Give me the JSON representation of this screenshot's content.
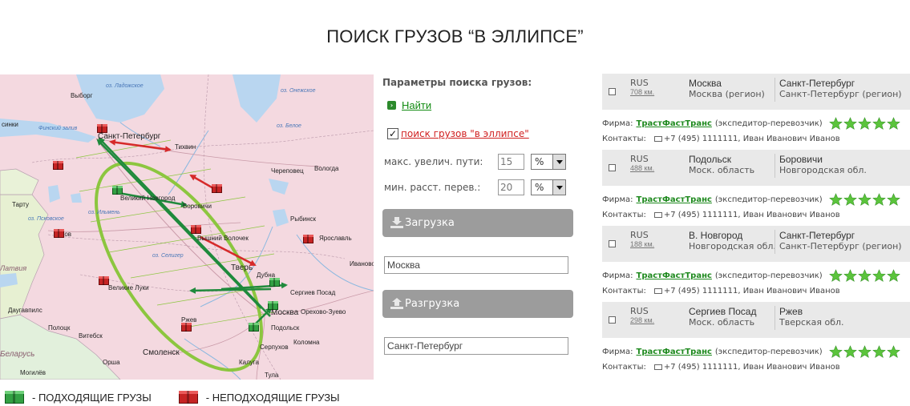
{
  "page": {
    "title": "ПОИСК ГРУЗОВ “В ЭЛЛИПСЕ”"
  },
  "map": {
    "labels": {
      "sinki": "синки",
      "finsky": "Финский залив",
      "vyborg": "Выборг",
      "ladoga": "оз. Ладожское",
      "onega": "оз. Онежское",
      "petersburg": "Санкт-Петербург",
      "tikhvin": "Тихвин",
      "cherepovets": "Череповец",
      "vologda": "Вологда",
      "beloe": "оз. Белое",
      "ilmen": "оз. Ильмень",
      "novgorod": "Великий Новгород",
      "tartu": "Тарту",
      "pskovskoe": "оз. Псковское",
      "pskov": "Псков",
      "borovichi": "Боровичи",
      "rybinsk": "Рыбинск",
      "yaroslavl": "Ярославль",
      "vyshny": "Вышний Волочёк",
      "vyshny_short": "Вышний Волочек",
      "seliger": "оз. Селигер",
      "tver": "Тверь",
      "ivanovo": "Иваново",
      "velikie_luki": "Великие Луки",
      "sergiev": "Сергиев Посад",
      "orekhovo": "Орехово-Зуево",
      "moskva": "Москва",
      "smolensk": "Смоленск",
      "kaluga": "Калуга",
      "tula": "Тула",
      "serpukhov": "Серпухов",
      "kolomna": "Коломна",
      "dubna": "Дубна",
      "rzhev": "Ржев",
      "podolsk": "Подольск",
      "vitebsk": "Витебск",
      "polotsk": "Полоцк",
      "daugavpils": "Даугавпилс",
      "orsha": "Орша",
      "moghilev": "Могилёв",
      "belarus": "Беларусь",
      "latvia": "Латвия"
    }
  },
  "params": {
    "heading": "Параметры поиска грузов:",
    "find_link": "Найти",
    "ellipse_checked": "✓",
    "ellipse_label": "поиск грузов \"в эллипсе\"",
    "max_path_label": "макс. увелич. пути:",
    "max_path_value": "15",
    "max_path_unit": "%",
    "min_dist_label": "мин. расст. перев.:",
    "min_dist_value": "20",
    "min_dist_unit": "%",
    "load_label": "Загрузка",
    "load_city": "Москва",
    "unload_label": "Разгрузка",
    "unload_city": "Санкт-Петербург"
  },
  "results": [
    {
      "country": "RUS",
      "km": "708 км.",
      "from": "Москва",
      "from_region": "Москва (регион)",
      "to": "Санкт-Петербург",
      "to_region": "Санкт-Петербург (регион)",
      "firm_label": "Фирма:",
      "firm_name": "ТрастФастТранс",
      "firm_type": "(экспедитор-перевозчик)",
      "contact_label": "Контакты:",
      "contact": "+7 (495) 1111111, Иван Иванович Иванов"
    },
    {
      "country": "RUS",
      "km": "488 км.",
      "from": "Подольск",
      "from_region": "Моск. область",
      "to": "Боровичи",
      "to_region": "Новгородская обл.",
      "firm_label": "Фирма:",
      "firm_name": "ТрастФастТранс",
      "firm_type": "(экспедитор-перевозчик)",
      "contact_label": "Контакты:",
      "contact": "+7 (495) 1111111, Иван Иванович Иванов"
    },
    {
      "country": "RUS",
      "km": "188 км.",
      "from": "В. Новгород",
      "from_region": "Новгородская обл.",
      "to": "Санкт-Петербург",
      "to_region": "Санкт-Петербург (регион)",
      "firm_label": "Фирма:",
      "firm_name": "ТрастФастТранс",
      "firm_type": "(экспедитор-перевозчик)",
      "contact_label": "Контакты:",
      "contact": "+7 (495) 1111111, Иван Иванович Иванов"
    },
    {
      "country": "RUS",
      "km": "298 км.",
      "from": "Сергиев Посад",
      "from_region": "Моск. область",
      "to": "Ржев",
      "to_region": "Тверская обл.",
      "firm_label": "Фирма:",
      "firm_name": "ТрастФастТранс",
      "firm_type": "(экспедитор-перевозчик)",
      "contact_label": "Контакты:",
      "contact": "+7 (495) 1111111, Иван Иванович Иванов"
    }
  ],
  "legend": {
    "suitable": "- ПОДХОДЯЩИЕ ГРУЗЫ",
    "unsuitable": "- НЕПОДХОДЯЩИЕ ГРУЗЫ"
  },
  "colors": {
    "ellipse": "#8cc63f",
    "suitable_arrow": "#1f8a3c",
    "unsuitable_arrow": "#d62a2a",
    "map_land": "#f4d9e0",
    "water": "#b9d6f0"
  }
}
